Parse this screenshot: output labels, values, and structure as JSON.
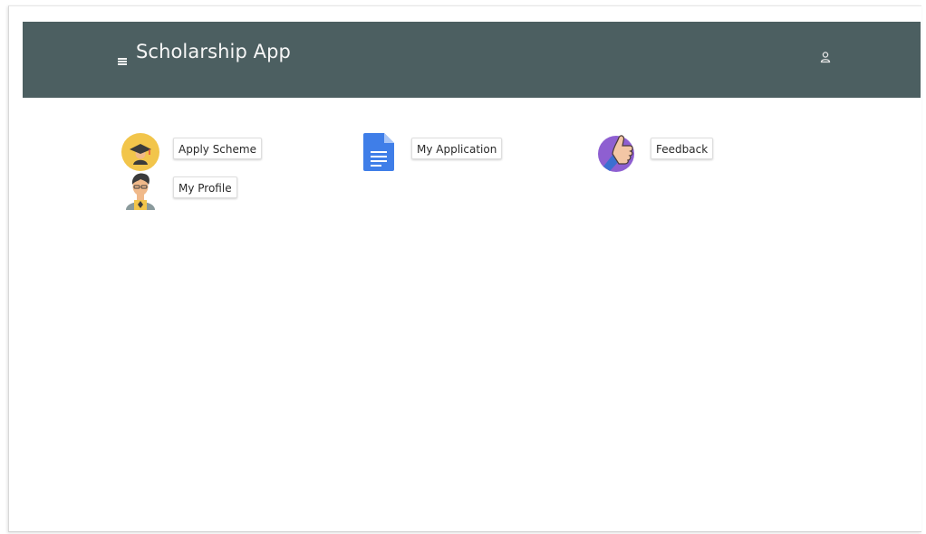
{
  "header": {
    "title": "Scholarship App",
    "menu_icon": "hamburger-menu-icon",
    "user_icon": "user-icon",
    "background_color": "#4c5f61"
  },
  "tiles": [
    {
      "label": "Apply Scheme",
      "icon": "graduate-icon"
    },
    {
      "label": "My Application",
      "icon": "document-icon"
    },
    {
      "label": "Feedback",
      "icon": "thumbs-up-icon"
    },
    {
      "label": "My Profile",
      "icon": "student-avatar-icon"
    }
  ]
}
